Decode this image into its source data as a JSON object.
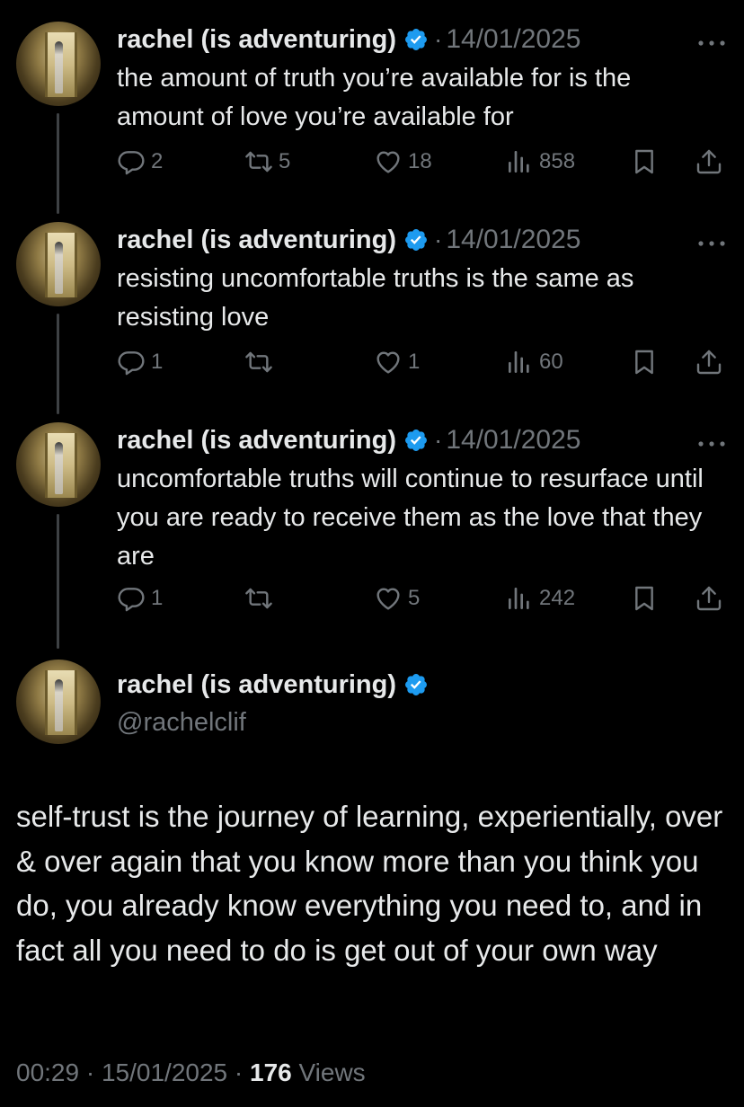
{
  "colors": {
    "background": "#000000",
    "text": "#e7e9ea",
    "secondary": "#71767b",
    "verified": "#1d9bf0",
    "thread_line": "#3e4144"
  },
  "thread": [
    {
      "author": "rachel (is adventuring)",
      "separator": "·",
      "date": "14/01/2025",
      "text": "the amount of truth you’re available for is the amount of love you’re available for",
      "replies": "2",
      "reposts": "5",
      "likes": "18",
      "views": "858"
    },
    {
      "author": "rachel (is adventuring)",
      "separator": "·",
      "date": "14/01/2025",
      "text": "resisting uncomfortable truths is the same as resisting love",
      "replies": "1",
      "reposts": "",
      "likes": "1",
      "views": "60"
    },
    {
      "author": "rachel (is adventuring)",
      "separator": "·",
      "date": "14/01/2025",
      "text": "uncomfortable truths will continue to resurface until you are ready to receive them as the love that they are",
      "replies": "1",
      "reposts": "",
      "likes": "5",
      "views": "242"
    }
  ],
  "main_post": {
    "author": "rachel (is adventuring)",
    "handle": "@rachelclif",
    "text": "self-trust is the journey of learning, experientially, over & over again that you know more than you think you do, you already know everything you need to, and in fact all you need to do is get out of your own way",
    "time": "00:29",
    "separator": "·",
    "date": "15/01/2025",
    "separator2": "·",
    "views_count": "176",
    "views_label": "Views"
  },
  "icons": {
    "reply": "reply-icon",
    "repost": "repost-icon",
    "like": "heart-icon",
    "views": "views-icon",
    "bookmark": "bookmark-icon",
    "share": "share-icon",
    "more": "more-icon",
    "verified": "verified-badge-icon"
  }
}
